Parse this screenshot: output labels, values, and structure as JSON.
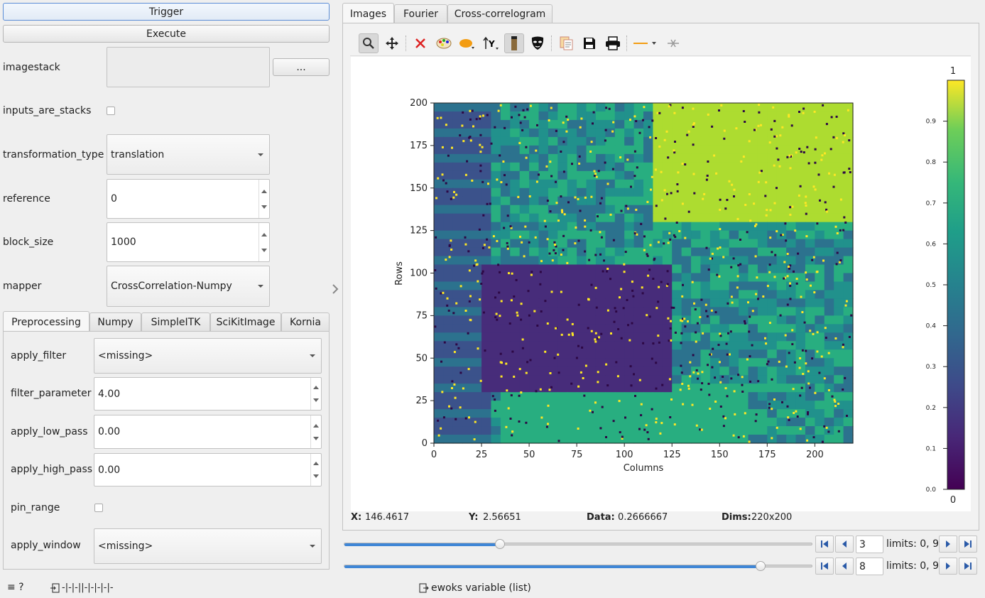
{
  "left": {
    "trigger_label": "Trigger",
    "execute_label": "Execute",
    "params": {
      "imagestack": {
        "label": "imagestack",
        "browse_label": "..."
      },
      "inputs_are_stacks": {
        "label": "inputs_are_stacks"
      },
      "transformation_type": {
        "label": "transformation_type",
        "value": "translation"
      },
      "reference": {
        "label": "reference",
        "value": "0"
      },
      "block_size": {
        "label": "block_size",
        "value": "1000"
      },
      "mapper": {
        "label": "mapper",
        "value": "CrossCorrelation-Numpy"
      }
    },
    "tabs": [
      "Preprocessing",
      "Numpy",
      "SimpleITK",
      "SciKitImage",
      "Kornia"
    ],
    "pre": {
      "apply_filter": {
        "label": "apply_filter",
        "value": "<missing>"
      },
      "filter_parameter": {
        "label": "filter_parameter",
        "value": "4.00"
      },
      "apply_low_pass": {
        "label": "apply_low_pass",
        "value": "0.00"
      },
      "apply_high_pass": {
        "label": "apply_high_pass",
        "value": "0.00"
      },
      "pin_range": {
        "label": "pin_range"
      },
      "apply_window": {
        "label": "apply_window",
        "value": "<missing>"
      }
    }
  },
  "right": {
    "tabs": [
      "Images",
      "Fourier",
      "Cross-correlogram"
    ],
    "toolbar": [
      "zoom-icon",
      "pan-icon",
      "reset-icon",
      "colormap-icon",
      "aspect-icon",
      "y-axis-icon",
      "keep-aspect-icon",
      "mask-icon",
      "copy-icon",
      "save-icon",
      "print-icon",
      "line-style-icon",
      "crosshair-icon"
    ]
  },
  "chart_data": {
    "type": "heatmap",
    "xlabel": "Columns",
    "ylabel": "Rows",
    "xlim": [
      0,
      220
    ],
    "ylim": [
      0,
      200
    ],
    "xticks": [
      "0",
      "25",
      "50",
      "75",
      "100",
      "125",
      "150",
      "175",
      "200"
    ],
    "yticks": [
      "0",
      "25",
      "50",
      "75",
      "100",
      "125",
      "150",
      "175",
      "200"
    ],
    "colorbar": {
      "min_label": "0",
      "max_label": "1",
      "ticks": [
        "0.0",
        "0.1",
        "0.2",
        "0.3",
        "0.4",
        "0.5",
        "0.6",
        "0.7",
        "0.8",
        "0.9"
      ],
      "colormap": "viridis"
    }
  },
  "status": {
    "x_label": "X:",
    "x_value": "146.4617",
    "y_label": "Y:",
    "y_value": "2.56651",
    "data_label": "Data:",
    "data_value": "0.2666667",
    "dims_label": "Dims:",
    "dims_value": "220x200"
  },
  "sliders": [
    {
      "value": "3",
      "limits": "limits: 0, 9",
      "fraction": 0.333
    },
    {
      "value": "8",
      "limits": "limits: 0, 9",
      "fraction": 0.889
    }
  ],
  "bottom": {
    "menu_text": "≡ ?",
    "signal_text": "-|-|-||-|-|-|-|-",
    "variable_text": "ewoks variable (list)"
  }
}
